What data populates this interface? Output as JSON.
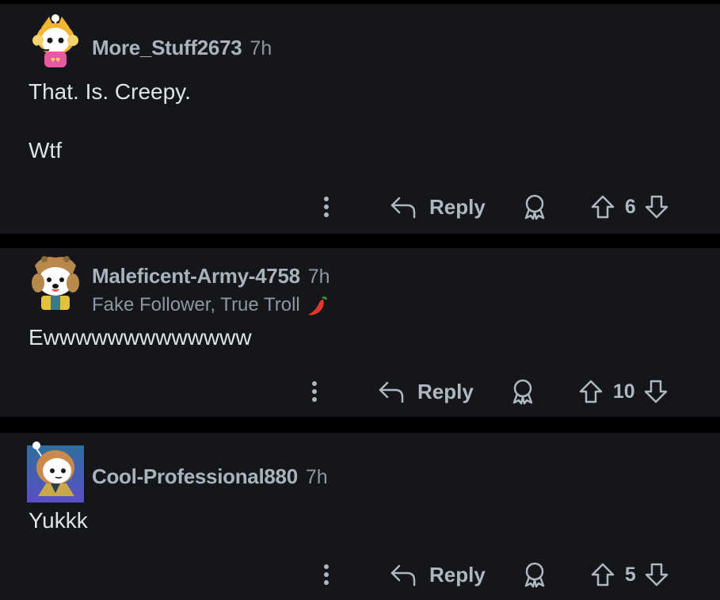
{
  "comments": [
    {
      "author": "More_Stuff2673",
      "time": "7h",
      "flair": "",
      "body": "That. Is. Creepy.\n\nWtf",
      "reply_label": "Reply",
      "score": "6",
      "avatar_colors": {
        "bg": "#14161a",
        "hair": "#f2b632",
        "shirt": "#e85aa0",
        "face": "#ffffff"
      }
    },
    {
      "author": "Maleficent-Army-4758",
      "time": "7h",
      "flair": "Fake Follower, True Troll",
      "flair_emoji": "chili-pepper-icon",
      "body": "Ewwwwwwwwwwwww",
      "reply_label": "Reply",
      "score": "10",
      "avatar_colors": {
        "bg": "#14161a",
        "hat": "#b8894a",
        "outfit": "#e3c13a",
        "face": "#ffffff"
      }
    },
    {
      "author": "Cool-Professional880",
      "time": "7h",
      "flair": "",
      "body": "Yukkk",
      "reply_label": "Reply",
      "score": "5",
      "avatar_colors": {
        "bg_top": "#2e6f9e",
        "bg_bottom": "#5a4ec4",
        "hair": "#c98a4a",
        "face": "#ffffff"
      }
    }
  ],
  "icons": {
    "more": "more-vertical-icon",
    "reply": "reply-arrow-icon",
    "award": "award-icon",
    "upvote": "upvote-arrow-icon",
    "downvote": "downvote-arrow-icon"
  },
  "theme": {
    "page_bg": "#000000",
    "card_bg": "#14161a",
    "author_color": "#a8b3bd",
    "body_color": "#dfe3e6",
    "action_color": "#aeb8c1"
  }
}
